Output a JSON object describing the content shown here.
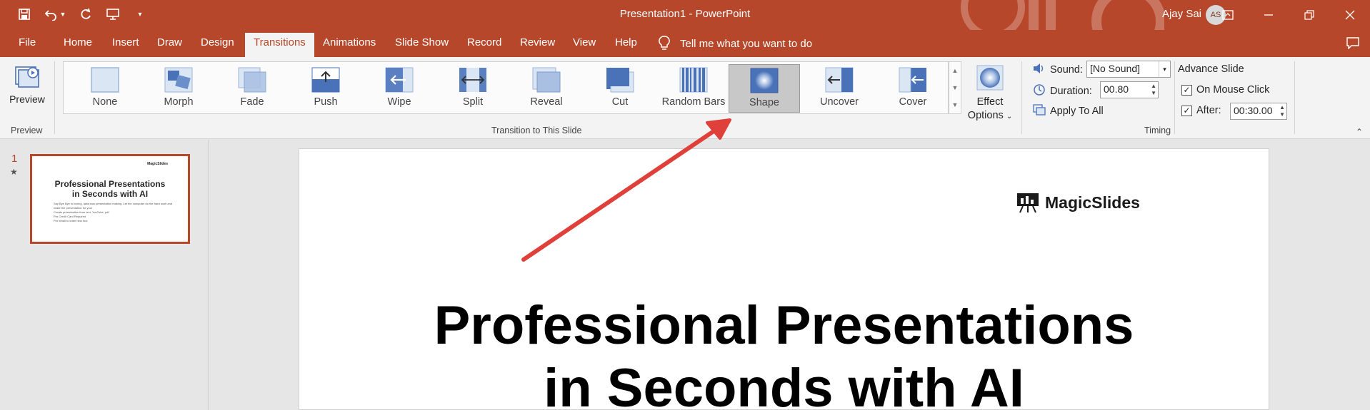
{
  "window": {
    "title": "Presentation1  -  PowerPoint",
    "user_name": "Ajay Sai",
    "user_initials": "AS"
  },
  "tabs": [
    {
      "label": "File"
    },
    {
      "label": "Home"
    },
    {
      "label": "Insert"
    },
    {
      "label": "Draw"
    },
    {
      "label": "Design"
    },
    {
      "label": "Transitions",
      "active": true
    },
    {
      "label": "Animations"
    },
    {
      "label": "Slide Show"
    },
    {
      "label": "Record"
    },
    {
      "label": "Review"
    },
    {
      "label": "View"
    },
    {
      "label": "Help"
    }
  ],
  "tell_me": "Tell me what you want to do",
  "ribbon": {
    "preview_label": "Preview",
    "preview_group": "Preview",
    "transition_group": "Transition to This Slide",
    "transitions": [
      "None",
      "Morph",
      "Fade",
      "Push",
      "Wipe",
      "Split",
      "Reveal",
      "Cut",
      "Random Bars",
      "Shape",
      "Uncover",
      "Cover"
    ],
    "selected_transition": "Shape",
    "effect_options_line1": "Effect",
    "effect_options_line2": "Options",
    "sound_label": "Sound:",
    "sound_value": "[No Sound]",
    "duration_label": "Duration:",
    "duration_value": "00.80",
    "apply_all_label": "Apply To All",
    "advance_slide_label": "Advance Slide",
    "on_mouse_click_label": "On Mouse Click",
    "on_mouse_click_checked": true,
    "after_label": "After:",
    "after_checked": true,
    "after_value": "00:30.00",
    "timing_group": "Timing"
  },
  "slide_pane": {
    "slide_number": "1",
    "thumb_logo": "MagicSlides",
    "thumb_title_line1": "Professional Presentations",
    "thumb_title_line2": "in Seconds with AI",
    "thumb_body": [
      "Say Bye Bye to boring, laborious presentation making. Let the computer do the hard work and make the presentation for you!",
      "Create presentation from text, YouTube, pdf",
      "Pro Credit Card Required",
      "Pro email to learn new tool"
    ]
  },
  "slide": {
    "logo_text": "MagicSlides",
    "title_line1": "Professional Presentations",
    "title_line2": "in Seconds with AI"
  },
  "colors": {
    "accent": "#b7472a",
    "arrow": "#e0403a"
  }
}
